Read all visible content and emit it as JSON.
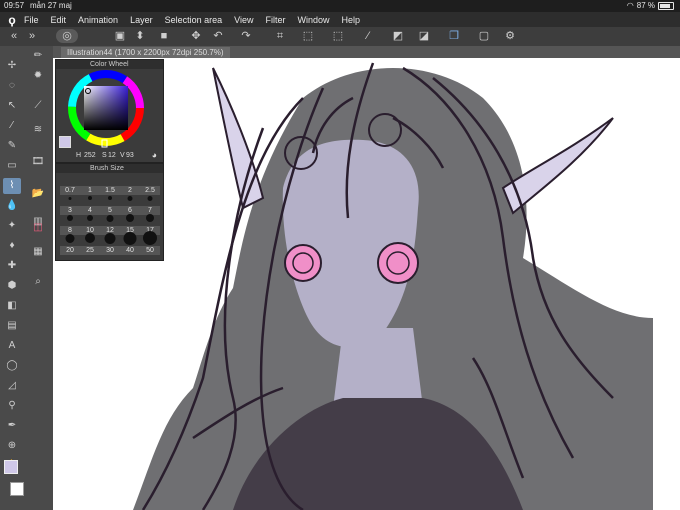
{
  "status_bar": {
    "time": "09:57",
    "date": "mån 27 maj",
    "battery": "87 %",
    "battery_level": 0.87
  },
  "menu": {
    "items": [
      "File",
      "Edit",
      "Animation",
      "Layer",
      "Selection area",
      "View",
      "Filter",
      "Window",
      "Help"
    ]
  },
  "document": {
    "tab_title": "Illustration44 (1700 x 2200px 72dpi 250.7%)"
  },
  "color_wheel": {
    "title": "Color Wheel",
    "h": "252",
    "s": "12",
    "v": "93",
    "main_color": "#cfc8e8"
  },
  "brush_size": {
    "title": "Brush Size",
    "sizes": [
      "0.7",
      "1",
      "1.5",
      "2",
      "2.5",
      "3",
      "4",
      "5",
      "6",
      "7",
      "8",
      "10",
      "12",
      "15",
      "17",
      "20",
      "25",
      "30",
      "40",
      "50"
    ]
  },
  "colors": {
    "accent": "#6d8fb3",
    "hair": "#6f6f72",
    "skin": "#b4b0c8",
    "eyes": "#f08fc8",
    "line": "#2a1e2e",
    "canvas": "#ffffff"
  }
}
